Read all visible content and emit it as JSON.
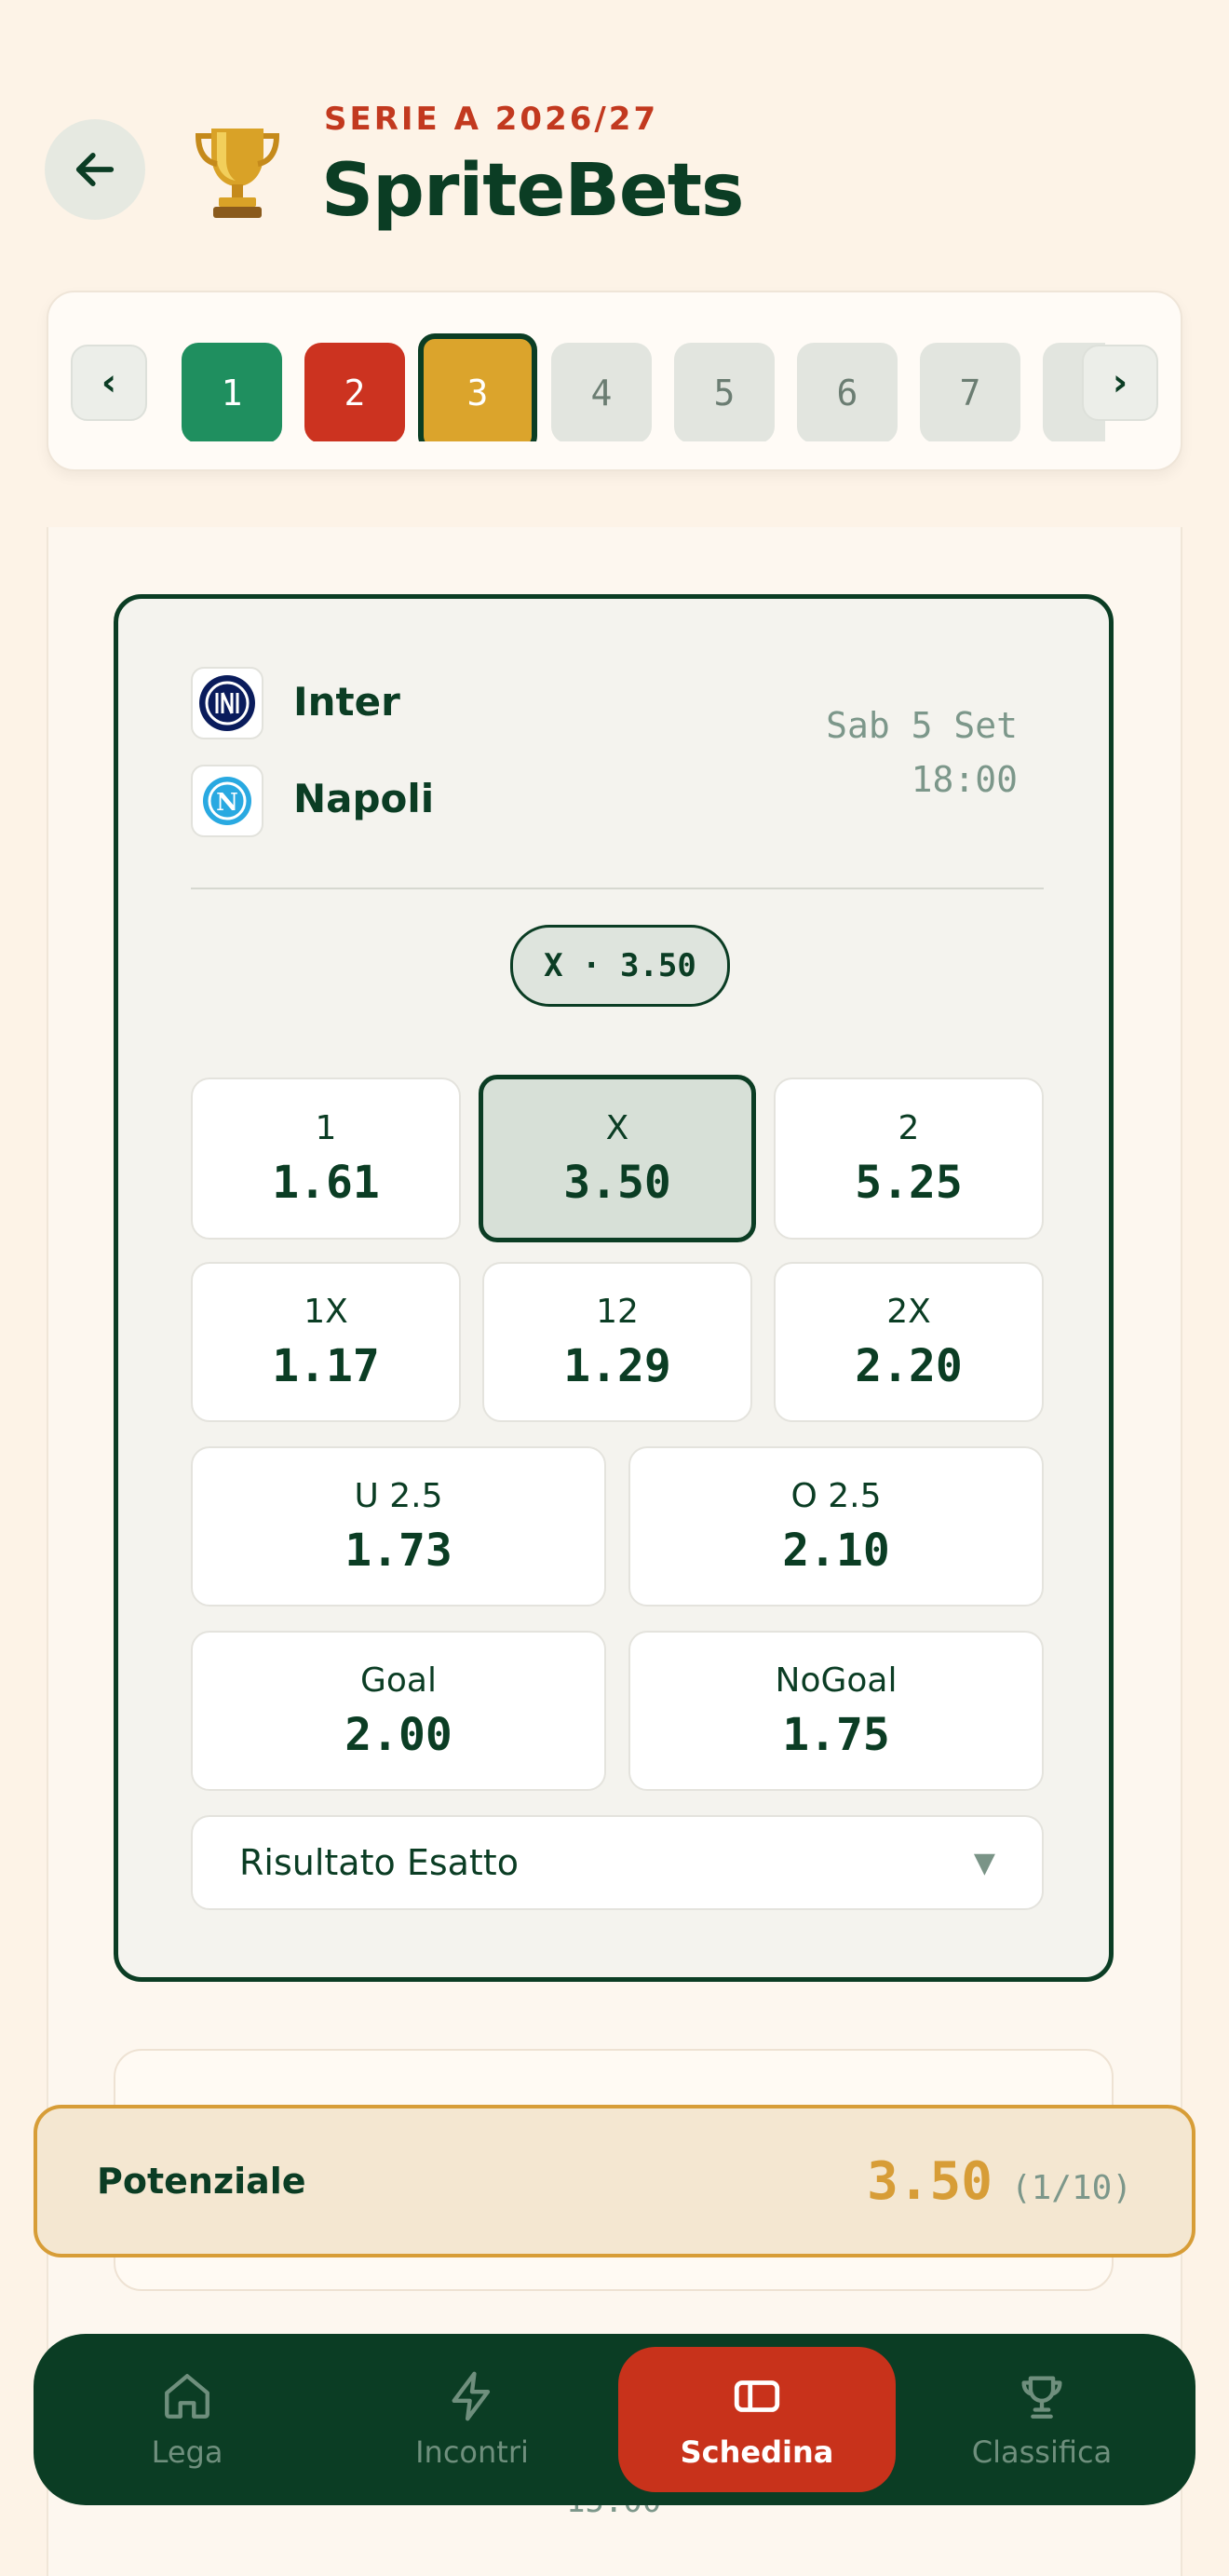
{
  "header": {
    "league_label": "SERIE A 2026/27",
    "app_title": "SpriteBets"
  },
  "rounds": {
    "prev_label": "‹",
    "next_label": "›",
    "items": [
      "1",
      "2",
      "3",
      "4",
      "5",
      "6",
      "7"
    ],
    "current": "3"
  },
  "match": {
    "home_team": "Inter",
    "away_team": "Napoli",
    "date": "Sab 5 Set",
    "time": "18:00",
    "selected_bet": "X · 3.50",
    "odds_row1": [
      {
        "label": "1",
        "value": "1.61"
      },
      {
        "label": "X",
        "value": "3.50"
      },
      {
        "label": "2",
        "value": "5.25"
      }
    ],
    "odds_row2": [
      {
        "label": "1X",
        "value": "1.17"
      },
      {
        "label": "12",
        "value": "1.29"
      },
      {
        "label": "2X",
        "value": "2.20"
      }
    ],
    "odds_row3": [
      {
        "label": "U 2.5",
        "value": "1.73"
      },
      {
        "label": "O 2.5",
        "value": "2.10"
      }
    ],
    "odds_row4": [
      {
        "label": "Goal",
        "value": "2.00"
      },
      {
        "label": "NoGoal",
        "value": "1.75"
      }
    ],
    "exact_score_label": "Risultato Esatto",
    "dropdown_caret": "▼"
  },
  "next_match_peek": {
    "time": "15:00"
  },
  "potential": {
    "label": "Potenziale",
    "amount": "3.50",
    "count": "(1/10)"
  },
  "bottom_nav": {
    "items": [
      {
        "label": "Lega"
      },
      {
        "label": "Incontri"
      },
      {
        "label": "Schedina"
      },
      {
        "label": "Classifica"
      }
    ],
    "active": "Schedina"
  },
  "colors": {
    "primary": "#0b3d24",
    "accent_red": "#c8321b",
    "accent_gold": "#d79d37",
    "win_green": "#1f8f5f",
    "background": "#fdf3e7"
  }
}
